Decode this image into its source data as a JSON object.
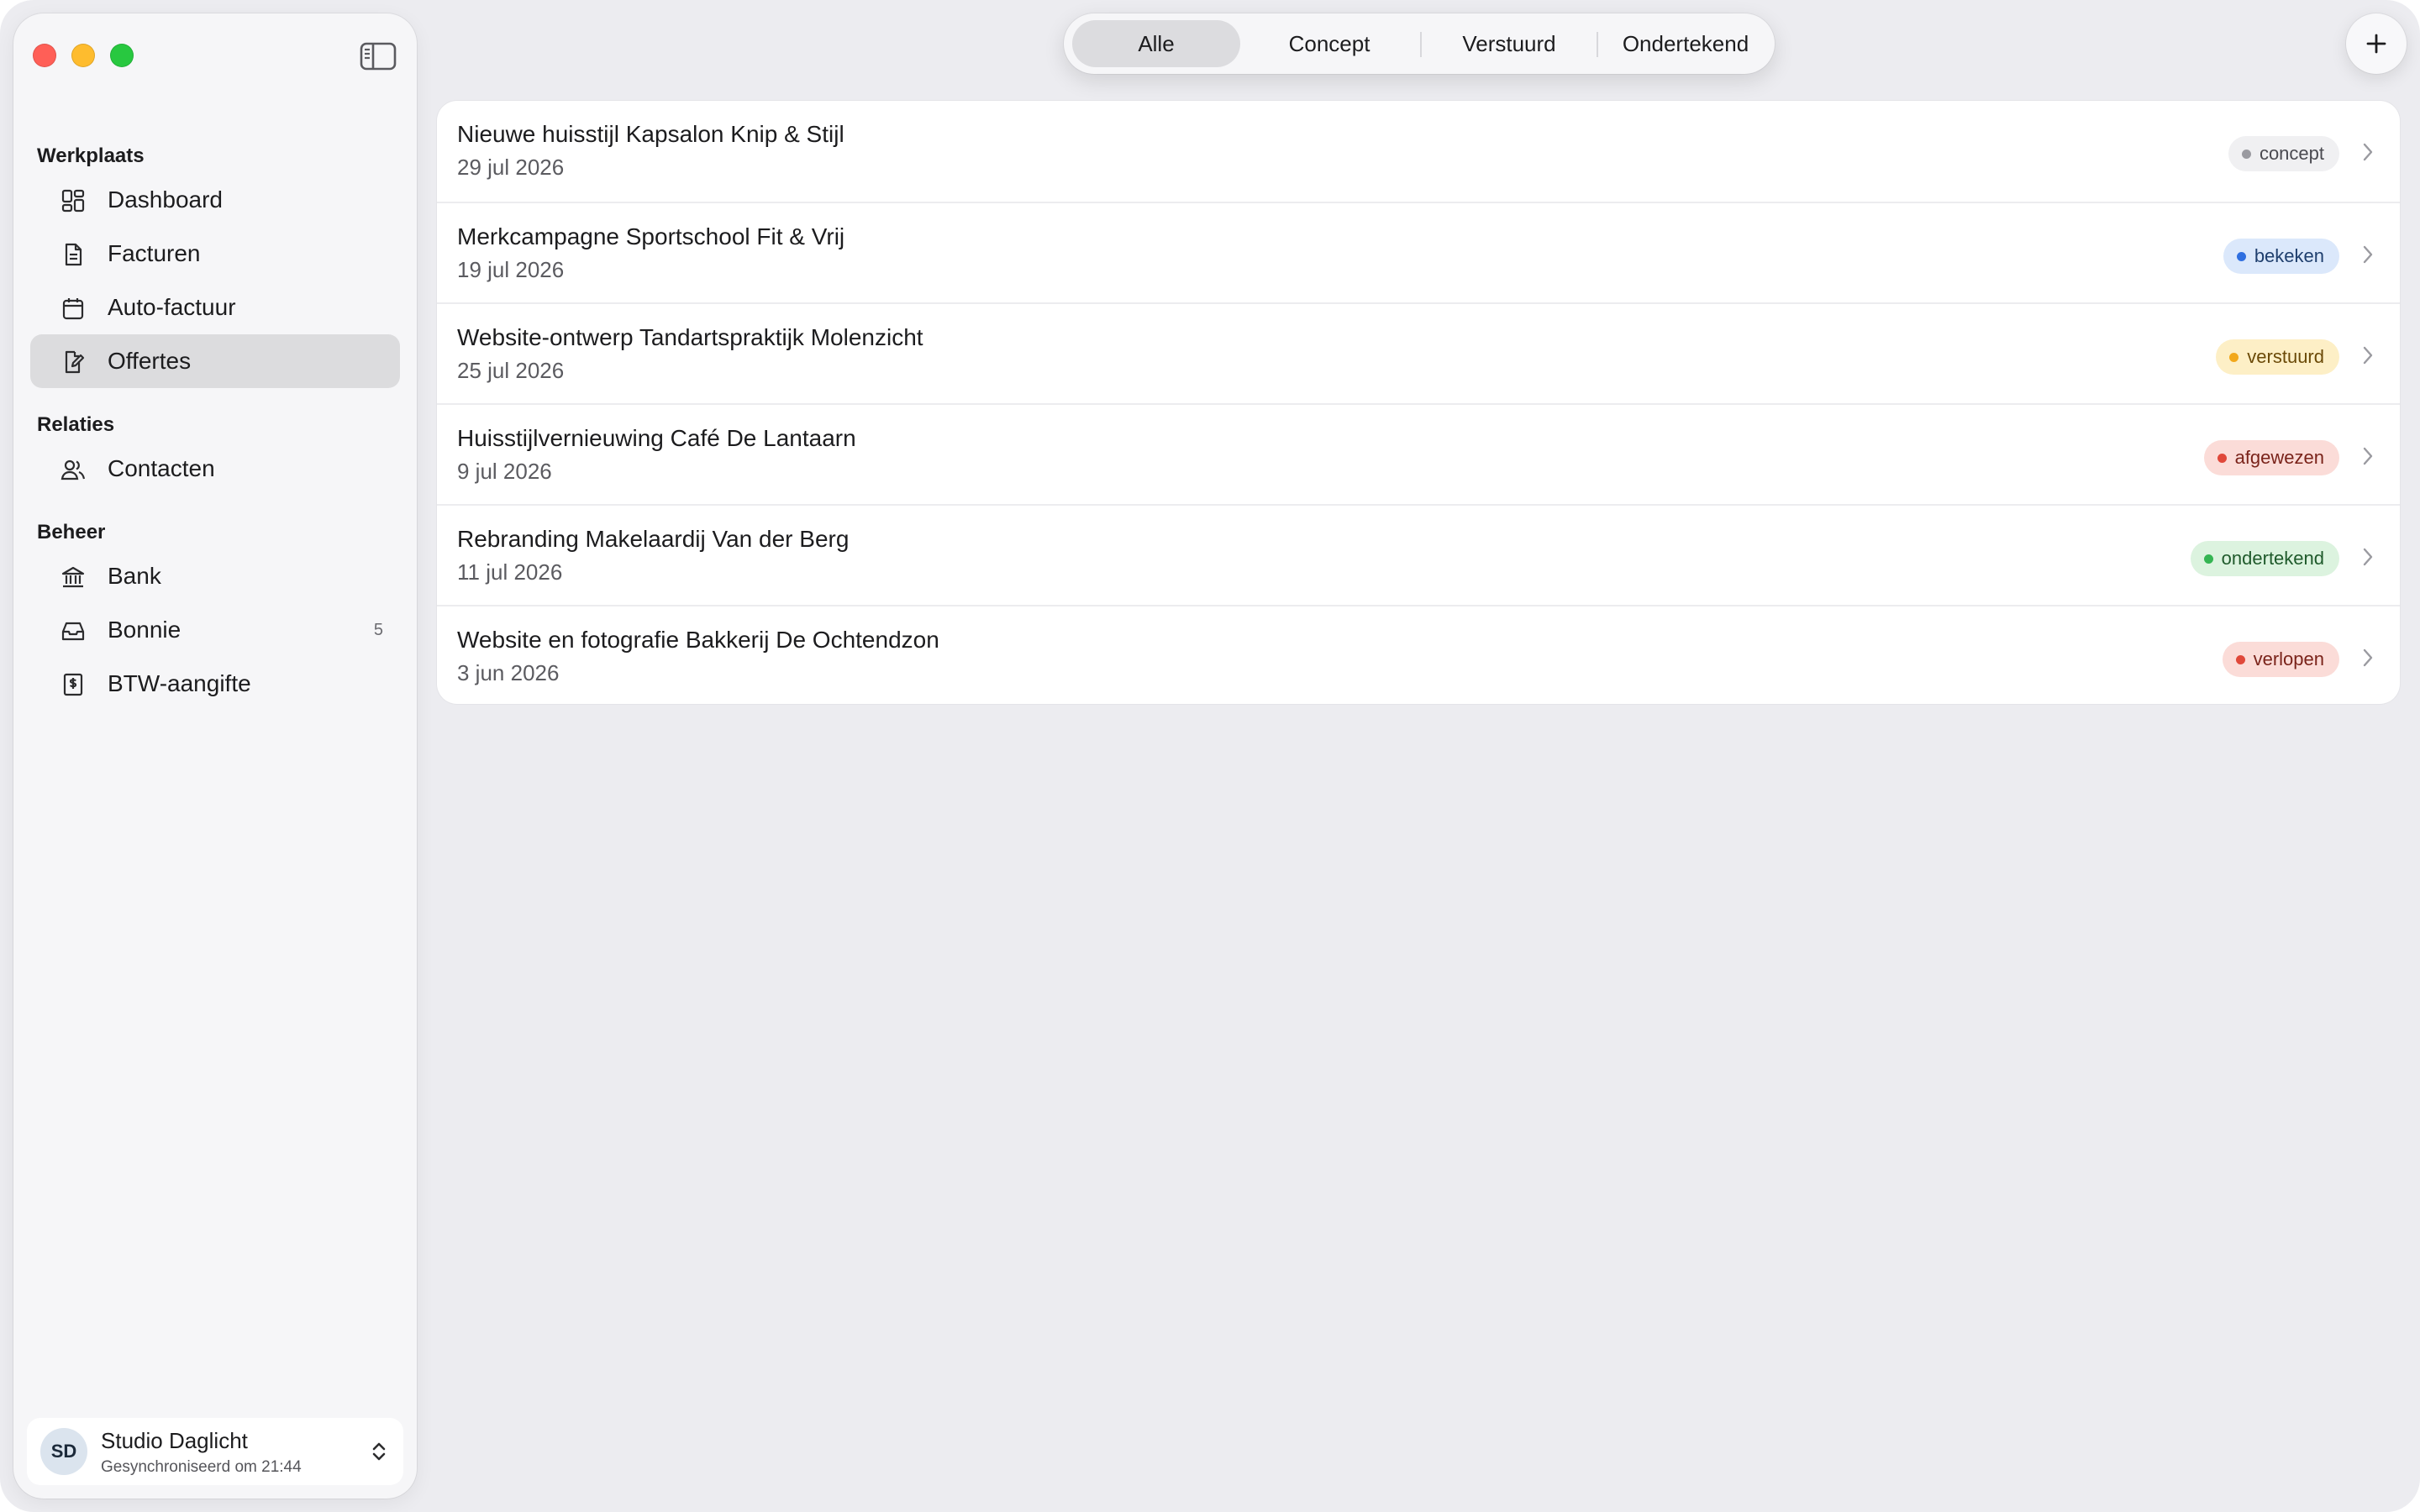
{
  "sidebar": {
    "sections": [
      {
        "title": "Werkplaats"
      },
      {
        "title": "Relaties"
      },
      {
        "title": "Beheer"
      }
    ],
    "items": [
      {
        "label": "Dashboard",
        "icon": "dashboard-icon"
      },
      {
        "label": "Facturen",
        "icon": "document-icon"
      },
      {
        "label": "Auto-factuur",
        "icon": "calendar-icon"
      },
      {
        "label": "Offertes",
        "icon": "document-edit-icon",
        "active": true
      },
      {
        "label": "Contacten",
        "icon": "people-icon"
      },
      {
        "label": "Bank",
        "icon": "bank-icon"
      },
      {
        "label": "Bonnie",
        "icon": "inbox-icon",
        "count": "5"
      },
      {
        "label": "BTW-aangifte",
        "icon": "tax-document-icon"
      }
    ],
    "account": {
      "initials": "SD",
      "name": "Studio Daglicht",
      "sync_status": "Gesynchroniseerd om 21:44"
    }
  },
  "filter_tabs": [
    {
      "label": "Alle",
      "active": true
    },
    {
      "label": "Concept"
    },
    {
      "label": "Verstuurd"
    },
    {
      "label": "Ondertekend"
    }
  ],
  "quotes": [
    {
      "title": "Nieuwe huisstijl Kapsalon Knip & Stijl",
      "date": "29 jul 2026",
      "status": "concept",
      "bg": "#f0f0f2",
      "dot": "#9a9aa0",
      "fg": "#4a4a50"
    },
    {
      "title": "Merkcampagne Sportschool Fit & Vrij",
      "date": "19 jul 2026",
      "status": "bekeken",
      "bg": "#dbe8fb",
      "dot": "#2f6fe0",
      "fg": "#1f3f6e"
    },
    {
      "title": "Website-ontwerp Tandartspraktijk Molenzicht",
      "date": "25 jul 2026",
      "status": "verstuurd",
      "bg": "#fdefc6",
      "dot": "#f2a81b",
      "fg": "#6b4a08"
    },
    {
      "title": "Huisstijlvernieuwing Café De Lantaarn",
      "date": "9 jul 2026",
      "status": "afgewezen",
      "bg": "#fbdcd8",
      "dot": "#e0483a",
      "fg": "#7a231a"
    },
    {
      "title": "Rebranding Makelaardij Van der Berg",
      "date": "11 jul 2026",
      "status": "ondertekend",
      "bg": "#dcf3df",
      "dot": "#34b552",
      "fg": "#1f5a2b"
    },
    {
      "title": "Website en fotografie Bakkerij De Ochtendzon",
      "date": "3 jun 2026",
      "status": "verlopen",
      "bg": "#fbdcd8",
      "dot": "#e0483a",
      "fg": "#7a231a"
    }
  ]
}
